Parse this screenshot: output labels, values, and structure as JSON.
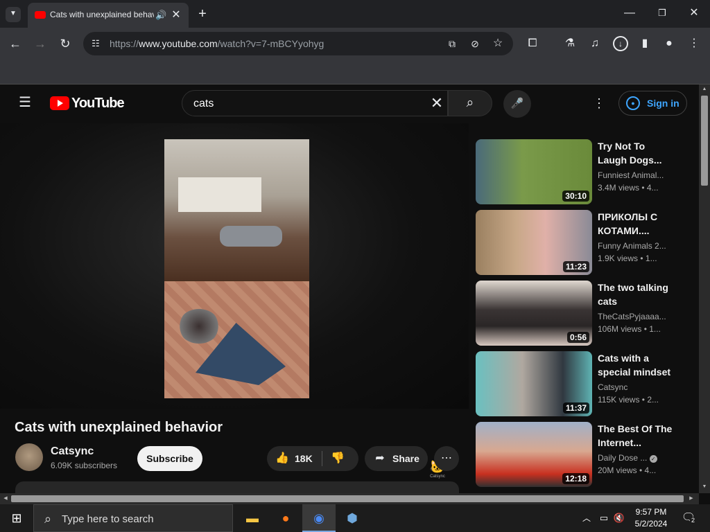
{
  "browser": {
    "tab_title": "Cats with unexplained behavior",
    "url_prefix": "https://",
    "url_domain": "www.youtube.com",
    "url_path": "/watch?v=7-mBCYyohyg"
  },
  "youtube": {
    "logo_text": "YouTube",
    "search_query": "cats",
    "signin_label": "Sign in",
    "video": {
      "title": "Cats with unexplained behavior",
      "channel": "Catsync",
      "subscribers": "6.09K subscribers",
      "subscribe_label": "Subscribe",
      "likes": "18K",
      "share_label": "Share",
      "watermark": "Catsync"
    },
    "recommendations": [
      {
        "title": "Try Not To Laugh Dogs...",
        "channel": "Funniest Animal...",
        "meta": "3.4M views • 4...",
        "duration": "30:10",
        "thumb": "#6a8a3a"
      },
      {
        "title": "ПРИКОЛЫ С КОТАМИ....",
        "channel": "Funny Animals 2...",
        "meta": "1.9K views • 1...",
        "duration": "11:23",
        "thumb": "#8a6a5a"
      },
      {
        "title": "The two talking cats",
        "channel": "TheCatsPyjaaaa...",
        "meta": "106M views • 1...",
        "duration": "0:56",
        "thumb": "#cfc4bc"
      },
      {
        "title": "Cats with a special mindset",
        "channel": "Catsync",
        "meta": "115K views • 2...",
        "duration": "11:37",
        "thumb": "#5fb3b3"
      },
      {
        "title": "The Best Of The Internet...",
        "channel": "Daily Dose ...",
        "meta": "20M views • 4...",
        "duration": "12:18",
        "thumb": "#8a9ab0"
      }
    ]
  },
  "taskbar": {
    "search_placeholder": "Type here to search",
    "time": "9:57 PM",
    "date": "5/2/2024",
    "notification_count": "2"
  }
}
